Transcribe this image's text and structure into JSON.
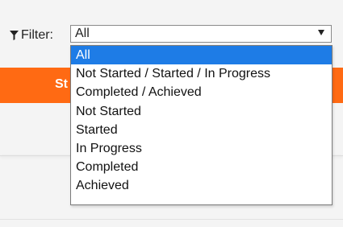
{
  "filter": {
    "label": "Filter:",
    "icon": "funnel-icon",
    "selected_value": "All",
    "options": [
      "All",
      "Not Started / Started / In Progress",
      "Completed / Achieved",
      "Not Started",
      "Started",
      "In Progress",
      "Completed",
      "Achieved"
    ],
    "highlighted_index": 0
  },
  "background": {
    "orange_button_label_partial": "St",
    "accent_color": "#ff6a13",
    "highlight_color": "#1e7ce6"
  }
}
